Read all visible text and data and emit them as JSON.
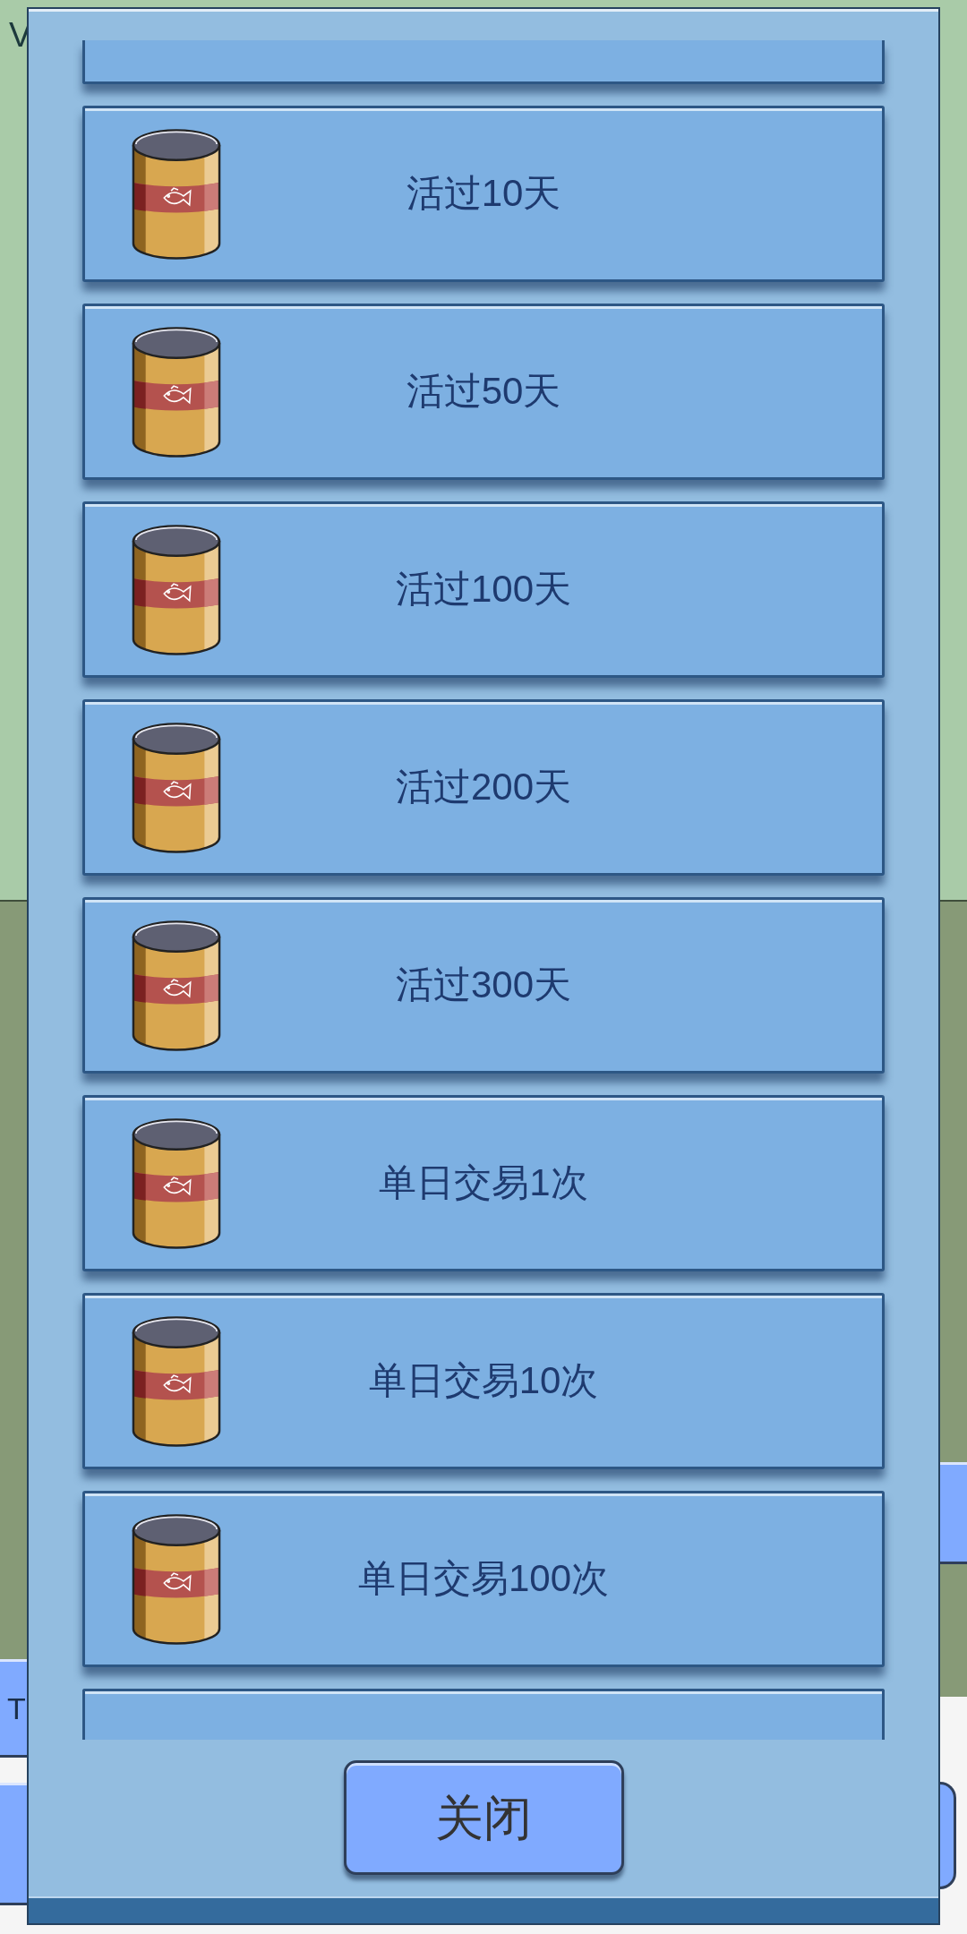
{
  "background": {
    "heading": "V",
    "side_button": "T"
  },
  "dialog": {
    "achievements": [
      {
        "title": "活过10天"
      },
      {
        "title": "活过50天"
      },
      {
        "title": "活过100天"
      },
      {
        "title": "活过200天"
      },
      {
        "title": "活过300天"
      },
      {
        "title": "单日交易1次"
      },
      {
        "title": "单日交易10次"
      },
      {
        "title": "单日交易100次"
      }
    ],
    "close_button": "关闭"
  }
}
